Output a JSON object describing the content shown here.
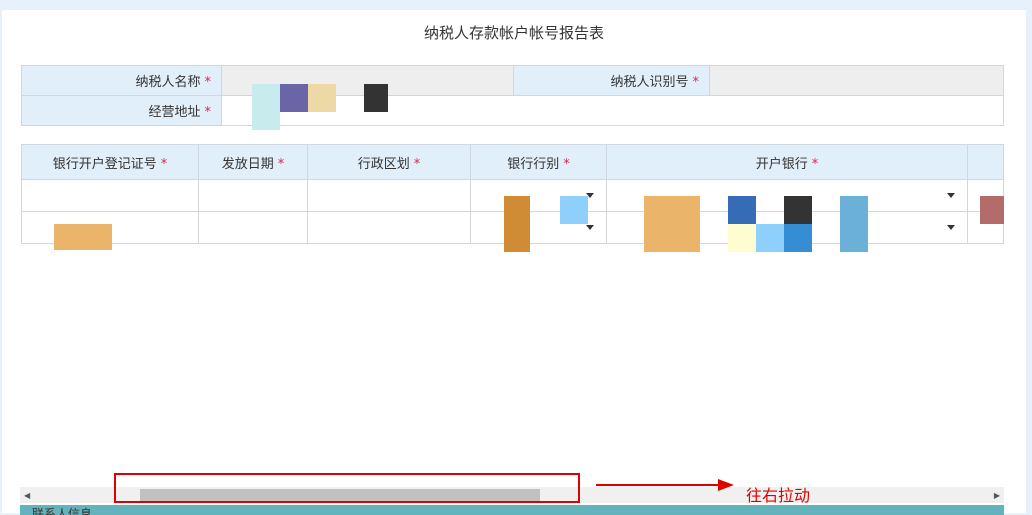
{
  "title": "纳税人存款帐户帐号报告表",
  "form": {
    "taxpayer_name_label": "纳税人名称",
    "taxpayer_id_label": "纳税人识别号",
    "address_label": "经营地址",
    "required": "*"
  },
  "grid": {
    "columns": [
      "银行开户登记证号",
      "发放日期",
      "行政区划",
      "银行行别",
      "开户银行"
    ],
    "required": "*"
  },
  "annotation": {
    "text": "往右拉动",
    "color": "#e00000"
  },
  "footer": {
    "label": "联系人信息"
  }
}
